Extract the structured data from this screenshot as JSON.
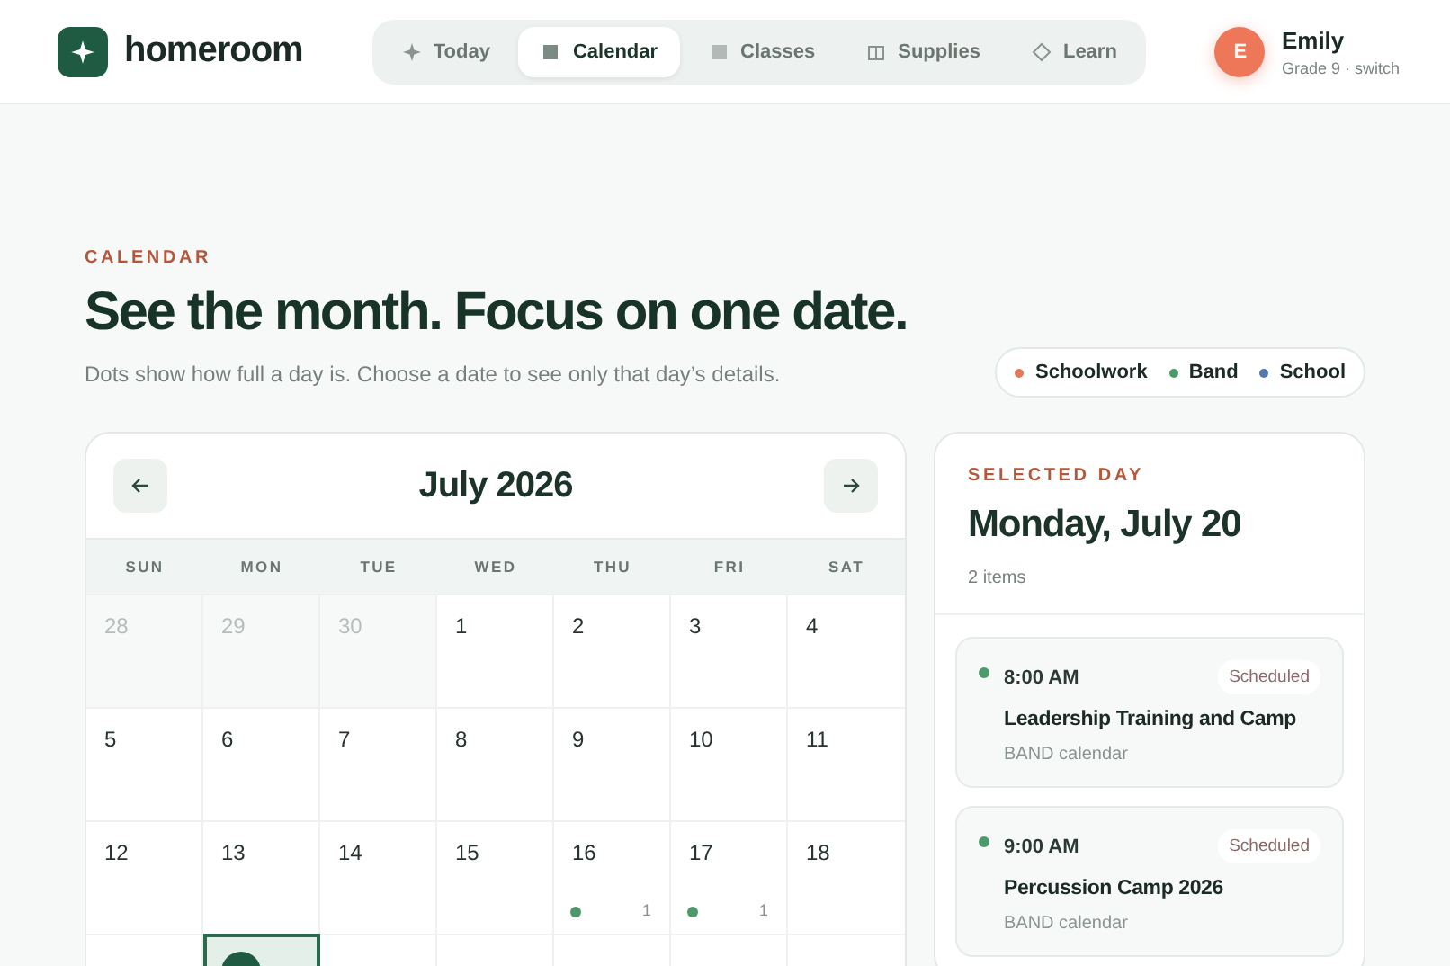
{
  "brand": {
    "name": "homeroom"
  },
  "nav": [
    {
      "label": "Today",
      "selected": false
    },
    {
      "label": "Calendar",
      "selected": true
    },
    {
      "label": "Classes",
      "selected": false
    },
    {
      "label": "Supplies",
      "selected": false
    },
    {
      "label": "Learn",
      "selected": false
    }
  ],
  "user": {
    "initial": "E",
    "name": "Emily",
    "detail": "Grade 9 · switch"
  },
  "eyebrow": "CALENDAR",
  "heading": "See the month. Focus on one date.",
  "subheading": "Dots show how full a day is. Choose a date to see only that day’s details.",
  "legend": [
    {
      "label": "Schoolwork",
      "color": "#e07b5a"
    },
    {
      "label": "Band",
      "color": "#4c9a6a"
    },
    {
      "label": "School",
      "color": "#5577b0"
    }
  ],
  "calendar": {
    "month": "July 2026",
    "weekdays": [
      "SUN",
      "MON",
      "TUE",
      "WED",
      "THU",
      "FRI",
      "SAT"
    ],
    "weeks": [
      [
        {
          "day": "28",
          "outside": true,
          "selected": false
        },
        {
          "day": "29",
          "outside": true,
          "selected": false
        },
        {
          "day": "30",
          "outside": true,
          "selected": false
        },
        {
          "day": "1",
          "outside": false,
          "selected": false
        },
        {
          "day": "2",
          "outside": false,
          "selected": false
        },
        {
          "day": "3",
          "outside": false,
          "selected": false
        },
        {
          "day": "4",
          "outside": false,
          "selected": false
        }
      ],
      [
        {
          "day": "5",
          "outside": false,
          "selected": false
        },
        {
          "day": "6",
          "outside": false,
          "selected": false
        },
        {
          "day": "7",
          "outside": false,
          "selected": false
        },
        {
          "day": "8",
          "outside": false,
          "selected": false
        },
        {
          "day": "9",
          "outside": false,
          "selected": false
        },
        {
          "day": "10",
          "outside": false,
          "selected": false
        },
        {
          "day": "11",
          "outside": false,
          "selected": false
        }
      ],
      [
        {
          "day": "12",
          "outside": false,
          "selected": false
        },
        {
          "day": "13",
          "outside": false,
          "selected": false
        },
        {
          "day": "14",
          "outside": false,
          "selected": false
        },
        {
          "day": "15",
          "outside": false,
          "selected": false
        },
        {
          "day": "16",
          "outside": false,
          "selected": false,
          "color": "#4c9a6a",
          "count": "1"
        },
        {
          "day": "17",
          "outside": false,
          "selected": false,
          "color": "#4c9a6a",
          "count": "1"
        },
        {
          "day": "18",
          "outside": false,
          "selected": false
        }
      ],
      [
        {
          "selected": false
        },
        {
          "selected": true
        },
        {
          "selected": false
        },
        {
          "selected": false
        },
        {
          "selected": false
        },
        {
          "selected": false
        },
        {
          "selected": false
        }
      ]
    ]
  },
  "selected_day": {
    "eyebrow": "SELECTED DAY",
    "title": "Monday, July 20",
    "count": "2 items",
    "events": [
      {
        "time": "8:00 AM",
        "status": "Scheduled",
        "title": "Leadership Training and Camp",
        "source": "BAND calendar",
        "color": "#4c9a6a"
      },
      {
        "time": "9:00 AM",
        "status": "Scheduled",
        "title": "Percussion Camp 2026",
        "source": "BAND calendar",
        "color": "#4c9a6a"
      }
    ]
  }
}
